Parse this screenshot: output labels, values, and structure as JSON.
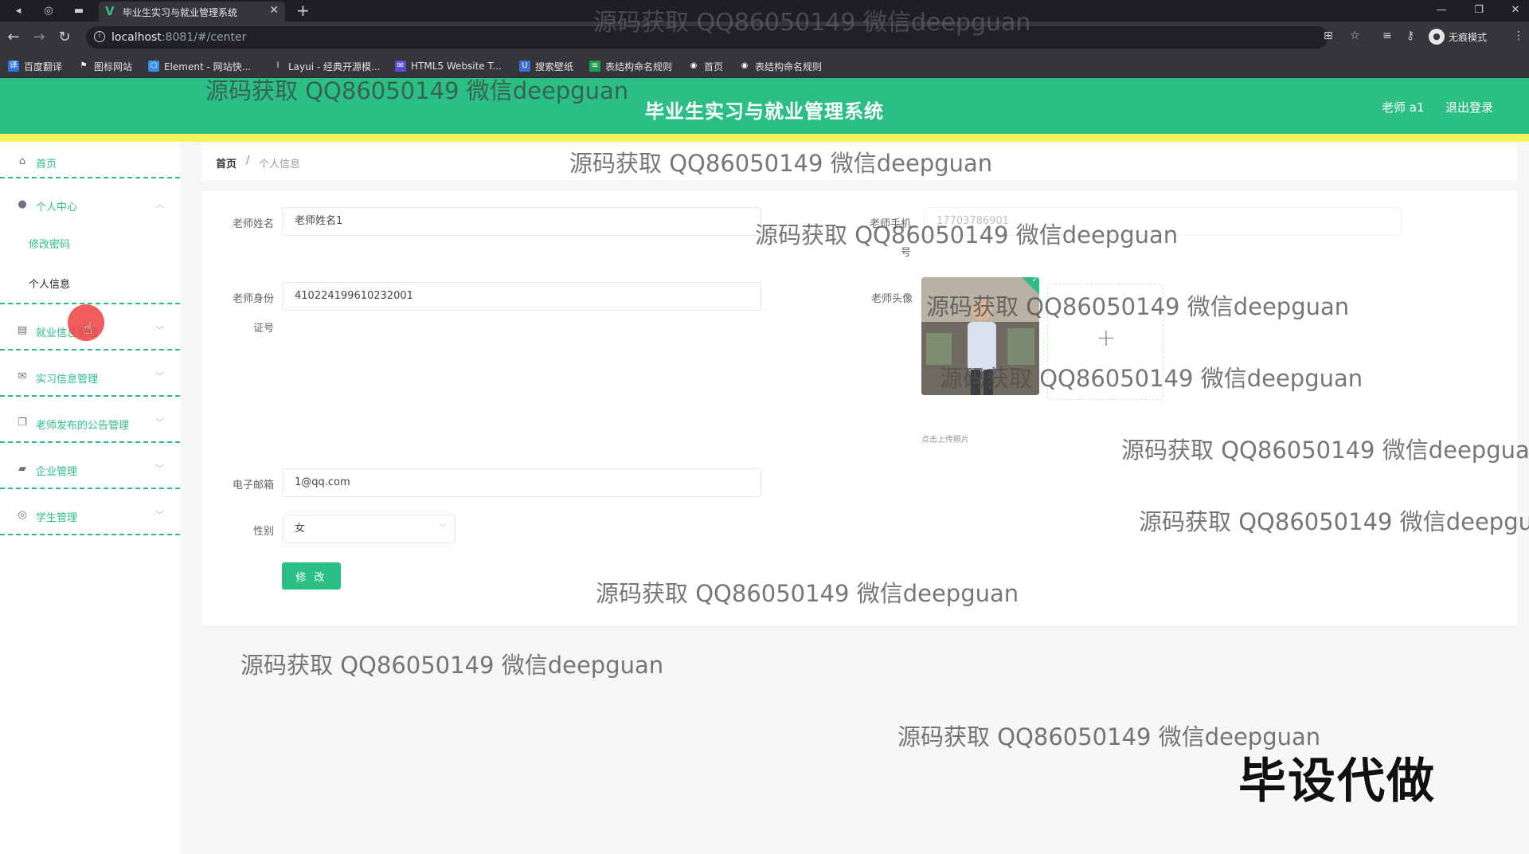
{
  "browser": {
    "tab_title": "毕业生实习与就业管理系统",
    "url_host": "localhost",
    "url_rest": ":8081/#/center",
    "profile_label": "无痕模式",
    "bookmarks": [
      {
        "label": "百度翻译",
        "color": "#2b74e2",
        "glyph": "译"
      },
      {
        "label": "图标网站",
        "color": "#1e1f22",
        "glyph": "⚑"
      },
      {
        "label": "Element - 网站快...",
        "color": "#3b8ee8",
        "glyph": "⬡"
      },
      {
        "label": "Layui - 经典开源模...",
        "color": "#35363a",
        "glyph": "l"
      },
      {
        "label": "HTML5 Website T...",
        "color": "#5a4fcf",
        "glyph": "✉"
      },
      {
        "label": "搜索壁纸",
        "color": "#3d6fd8",
        "glyph": "U"
      },
      {
        "label": "表结构命名规则",
        "color": "#1f9d55",
        "glyph": "≡"
      },
      {
        "label": "首页",
        "color": "#35363a",
        "glyph": "◉"
      },
      {
        "label": "表结构命名规则",
        "color": "#35363a",
        "glyph": "◉"
      }
    ]
  },
  "header": {
    "title": "毕业生实习与就业管理系统",
    "user": "老师 a1",
    "logout": "退出登录"
  },
  "sidebar": {
    "items": [
      {
        "label": "首页",
        "icon": "home-icon"
      },
      {
        "label": "个人中心",
        "icon": "user-icon"
      },
      {
        "label": "就业信息管理",
        "icon": "clipboard-icon"
      },
      {
        "label": "实习信息管理",
        "icon": "mail-icon"
      },
      {
        "label": "老师发布的公告管理",
        "icon": "copy-icon"
      },
      {
        "label": "企业管理",
        "icon": "briefcase-icon"
      },
      {
        "label": "学生管理",
        "icon": "compass-icon"
      }
    ],
    "sub_items": [
      "修改密码",
      "个人信息"
    ]
  },
  "breadcrumb": {
    "home": "首页",
    "separator": "/",
    "current": "个人信息"
  },
  "form": {
    "name_label": "老师姓名",
    "name_value": "老师姓名1",
    "phone_label_1": "老师手机",
    "phone_label_2": "号",
    "phone_value": "17703786901",
    "idcard_label_1": "老师身份",
    "idcard_label_2": "证号",
    "idcard_value": "410224199610232001",
    "avatar_label": "老师头像",
    "upload_hint": "点击上传照片",
    "email_label": "电子邮箱",
    "email_value": "1@qq.com",
    "gender_label": "性别",
    "gender_value": "女",
    "submit": "修 改"
  },
  "watermark": {
    "text": "源码获取 QQ86050149 微信deepguan",
    "text_cut_1": "源码获取 QQ86050149 微信deepgua",
    "text_cut_2": "源码获取 QQ86050149 微信deepgu",
    "stamp": "毕设代做"
  },
  "colors": {
    "primary": "#2bbf86",
    "accent_line": "#f5f35c"
  }
}
